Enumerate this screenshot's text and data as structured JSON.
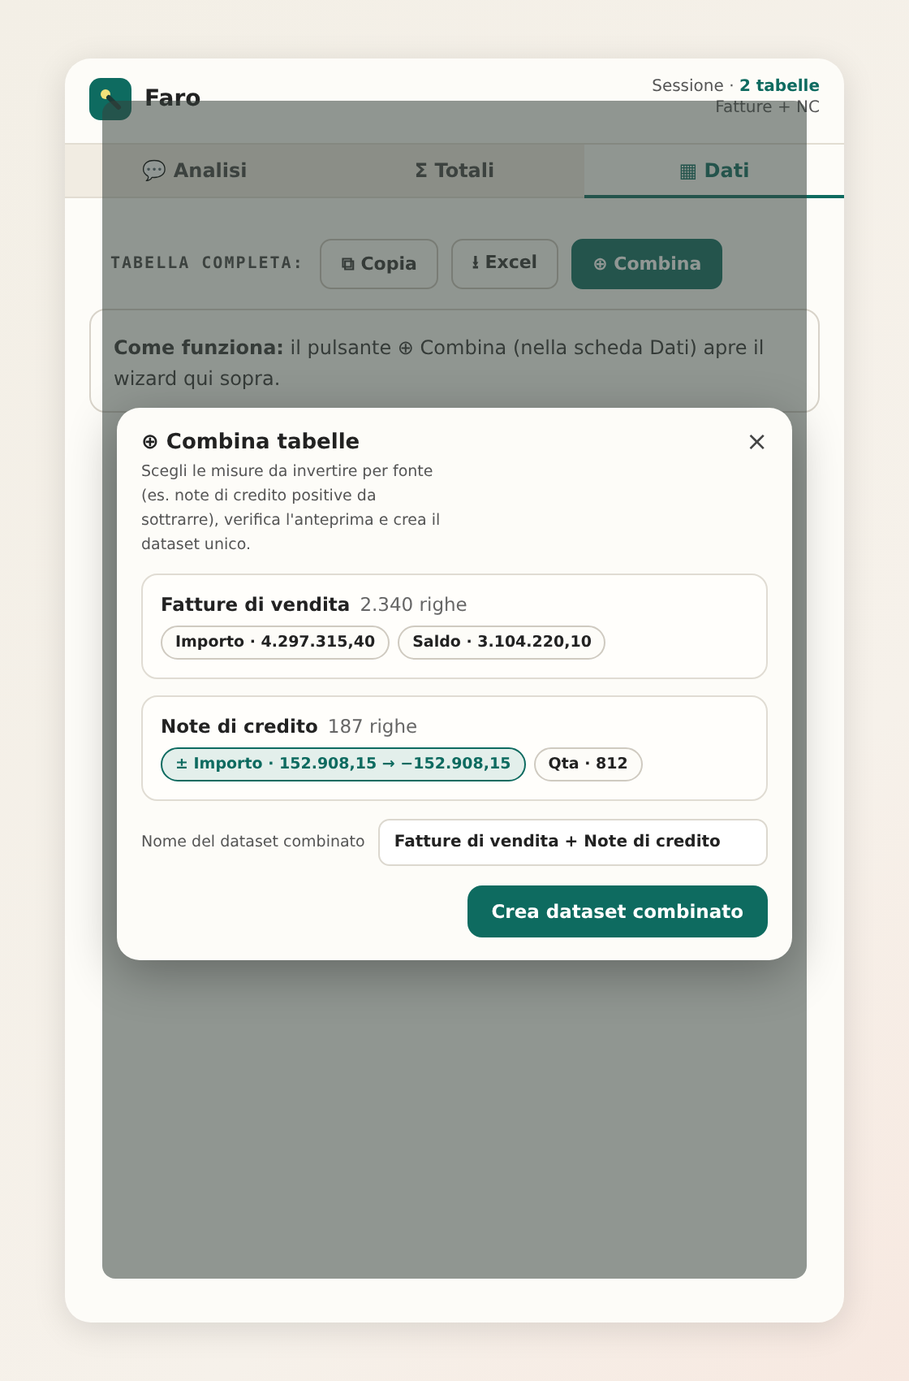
{
  "app": {
    "name": "Faro",
    "session_label": "Sessione ·",
    "session_count": "2 tabelle",
    "session_detail": "Fatture + NC"
  },
  "tabs": [
    {
      "icon": "💬",
      "label": "Analisi",
      "selected": false
    },
    {
      "icon": "Σ",
      "label": "Totali",
      "selected": false
    },
    {
      "icon": "▦",
      "label": "Dati",
      "selected": true
    }
  ],
  "toolbar": {
    "label": "TABELLA COMPLETA:",
    "buttons": [
      {
        "label": "⧉ Copia",
        "primary": false
      },
      {
        "label": "⭳ Excel",
        "primary": false
      },
      {
        "label": "⊕ Combina",
        "primary": true
      }
    ]
  },
  "info": "**Come funziona:** il pulsante ⊕ Combina (nella scheda Dati) apre il wizard qui sopra.",
  "dialog": {
    "title": "⊕ Combina tabelle",
    "close": "×",
    "description": "Scegli le misure da invertire per fonte (es. note di credito positive da sottrarre), verifica l'anteprima e crea il dataset unico.",
    "sources": [
      {
        "name": "Fatture di vendita",
        "rows": "2.340 righe",
        "measures": [
          {
            "label": "Importo · 4.297.315,40",
            "inverted": false
          },
          {
            "label": "Saldo · 3.104.220,10",
            "inverted": false
          }
        ]
      },
      {
        "name": "Note di credito",
        "rows": "187 righe",
        "measures": [
          {
            "label": "± Importo · 152.908,15 → −152.908,15",
            "inverted": true
          },
          {
            "label": "Qta · 812",
            "inverted": false
          }
        ]
      }
    ],
    "name_label": "Nome del dataset combinato",
    "name_value": "Fatture di vendita + Note di credito",
    "submit": "Crea dataset combinato"
  }
}
